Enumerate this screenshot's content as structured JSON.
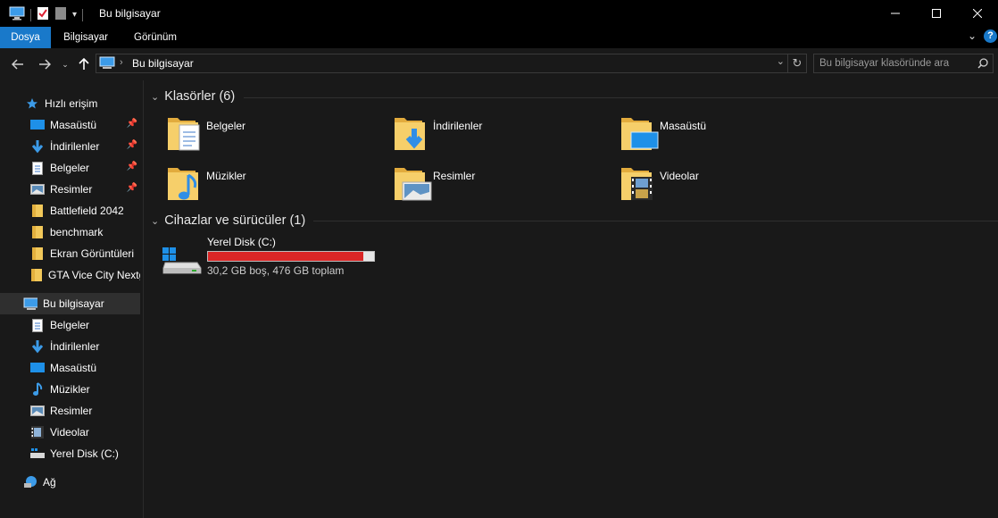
{
  "window": {
    "title": "Bu bilgisayar"
  },
  "ribbon": {
    "tabs": [
      {
        "label": "Dosya",
        "active": true
      },
      {
        "label": "Bilgisayar",
        "active": false
      },
      {
        "label": "Görünüm",
        "active": false
      }
    ]
  },
  "address": {
    "location": "Bu bilgisayar"
  },
  "search": {
    "placeholder": "Bu bilgisayar klasöründe ara"
  },
  "sidebar": {
    "quick_access": {
      "label": "Hızlı erişim",
      "icon": "star-icon"
    },
    "quick_items": [
      {
        "label": "Masaüstü",
        "icon": "desktop-icon",
        "pinned": true
      },
      {
        "label": "İndirilenler",
        "icon": "download-icon",
        "pinned": true
      },
      {
        "label": "Belgeler",
        "icon": "documents-icon",
        "pinned": true
      },
      {
        "label": "Resimler",
        "icon": "pictures-icon",
        "pinned": true
      },
      {
        "label": "Battlefield 2042",
        "icon": "folder-icon",
        "pinned": false
      },
      {
        "label": "benchmark",
        "icon": "folder-icon",
        "pinned": false
      },
      {
        "label": "Ekran Görüntüleri",
        "icon": "folder-icon",
        "pinned": false
      },
      {
        "label": "GTA Vice City Nextg",
        "icon": "folder-icon",
        "pinned": false
      }
    ],
    "this_pc": {
      "label": "Bu bilgisayar",
      "icon": "computer-icon"
    },
    "pc_items": [
      {
        "label": "Belgeler",
        "icon": "documents-icon"
      },
      {
        "label": "İndirilenler",
        "icon": "download-icon"
      },
      {
        "label": "Masaüstü",
        "icon": "desktop-icon"
      },
      {
        "label": "Müzikler",
        "icon": "music-icon"
      },
      {
        "label": "Resimler",
        "icon": "pictures-icon"
      },
      {
        "label": "Videolar",
        "icon": "videos-icon"
      },
      {
        "label": "Yerel Disk (C:)",
        "icon": "drive-icon"
      }
    ],
    "network": {
      "label": "Ağ",
      "icon": "network-icon"
    }
  },
  "main": {
    "folders_heading": "Klasörler (6)",
    "folders": [
      {
        "label": "Belgeler",
        "icon": "documents-folder-icon"
      },
      {
        "label": "İndirilenler",
        "icon": "downloads-folder-icon"
      },
      {
        "label": "Masaüstü",
        "icon": "desktop-folder-icon"
      },
      {
        "label": "Müzikler",
        "icon": "music-folder-icon"
      },
      {
        "label": "Resimler",
        "icon": "pictures-folder-icon"
      },
      {
        "label": "Videolar",
        "icon": "videos-folder-icon"
      }
    ],
    "devices_heading": "Cihazlar ve sürücüler (1)",
    "drive": {
      "name": "Yerel Disk (C:)",
      "info": "30,2 GB boş, 476 GB toplam",
      "used_fraction": 0.937,
      "bar_color": "#da2626"
    }
  },
  "colors": {
    "accent": "#1979ca",
    "background": "#191919"
  }
}
